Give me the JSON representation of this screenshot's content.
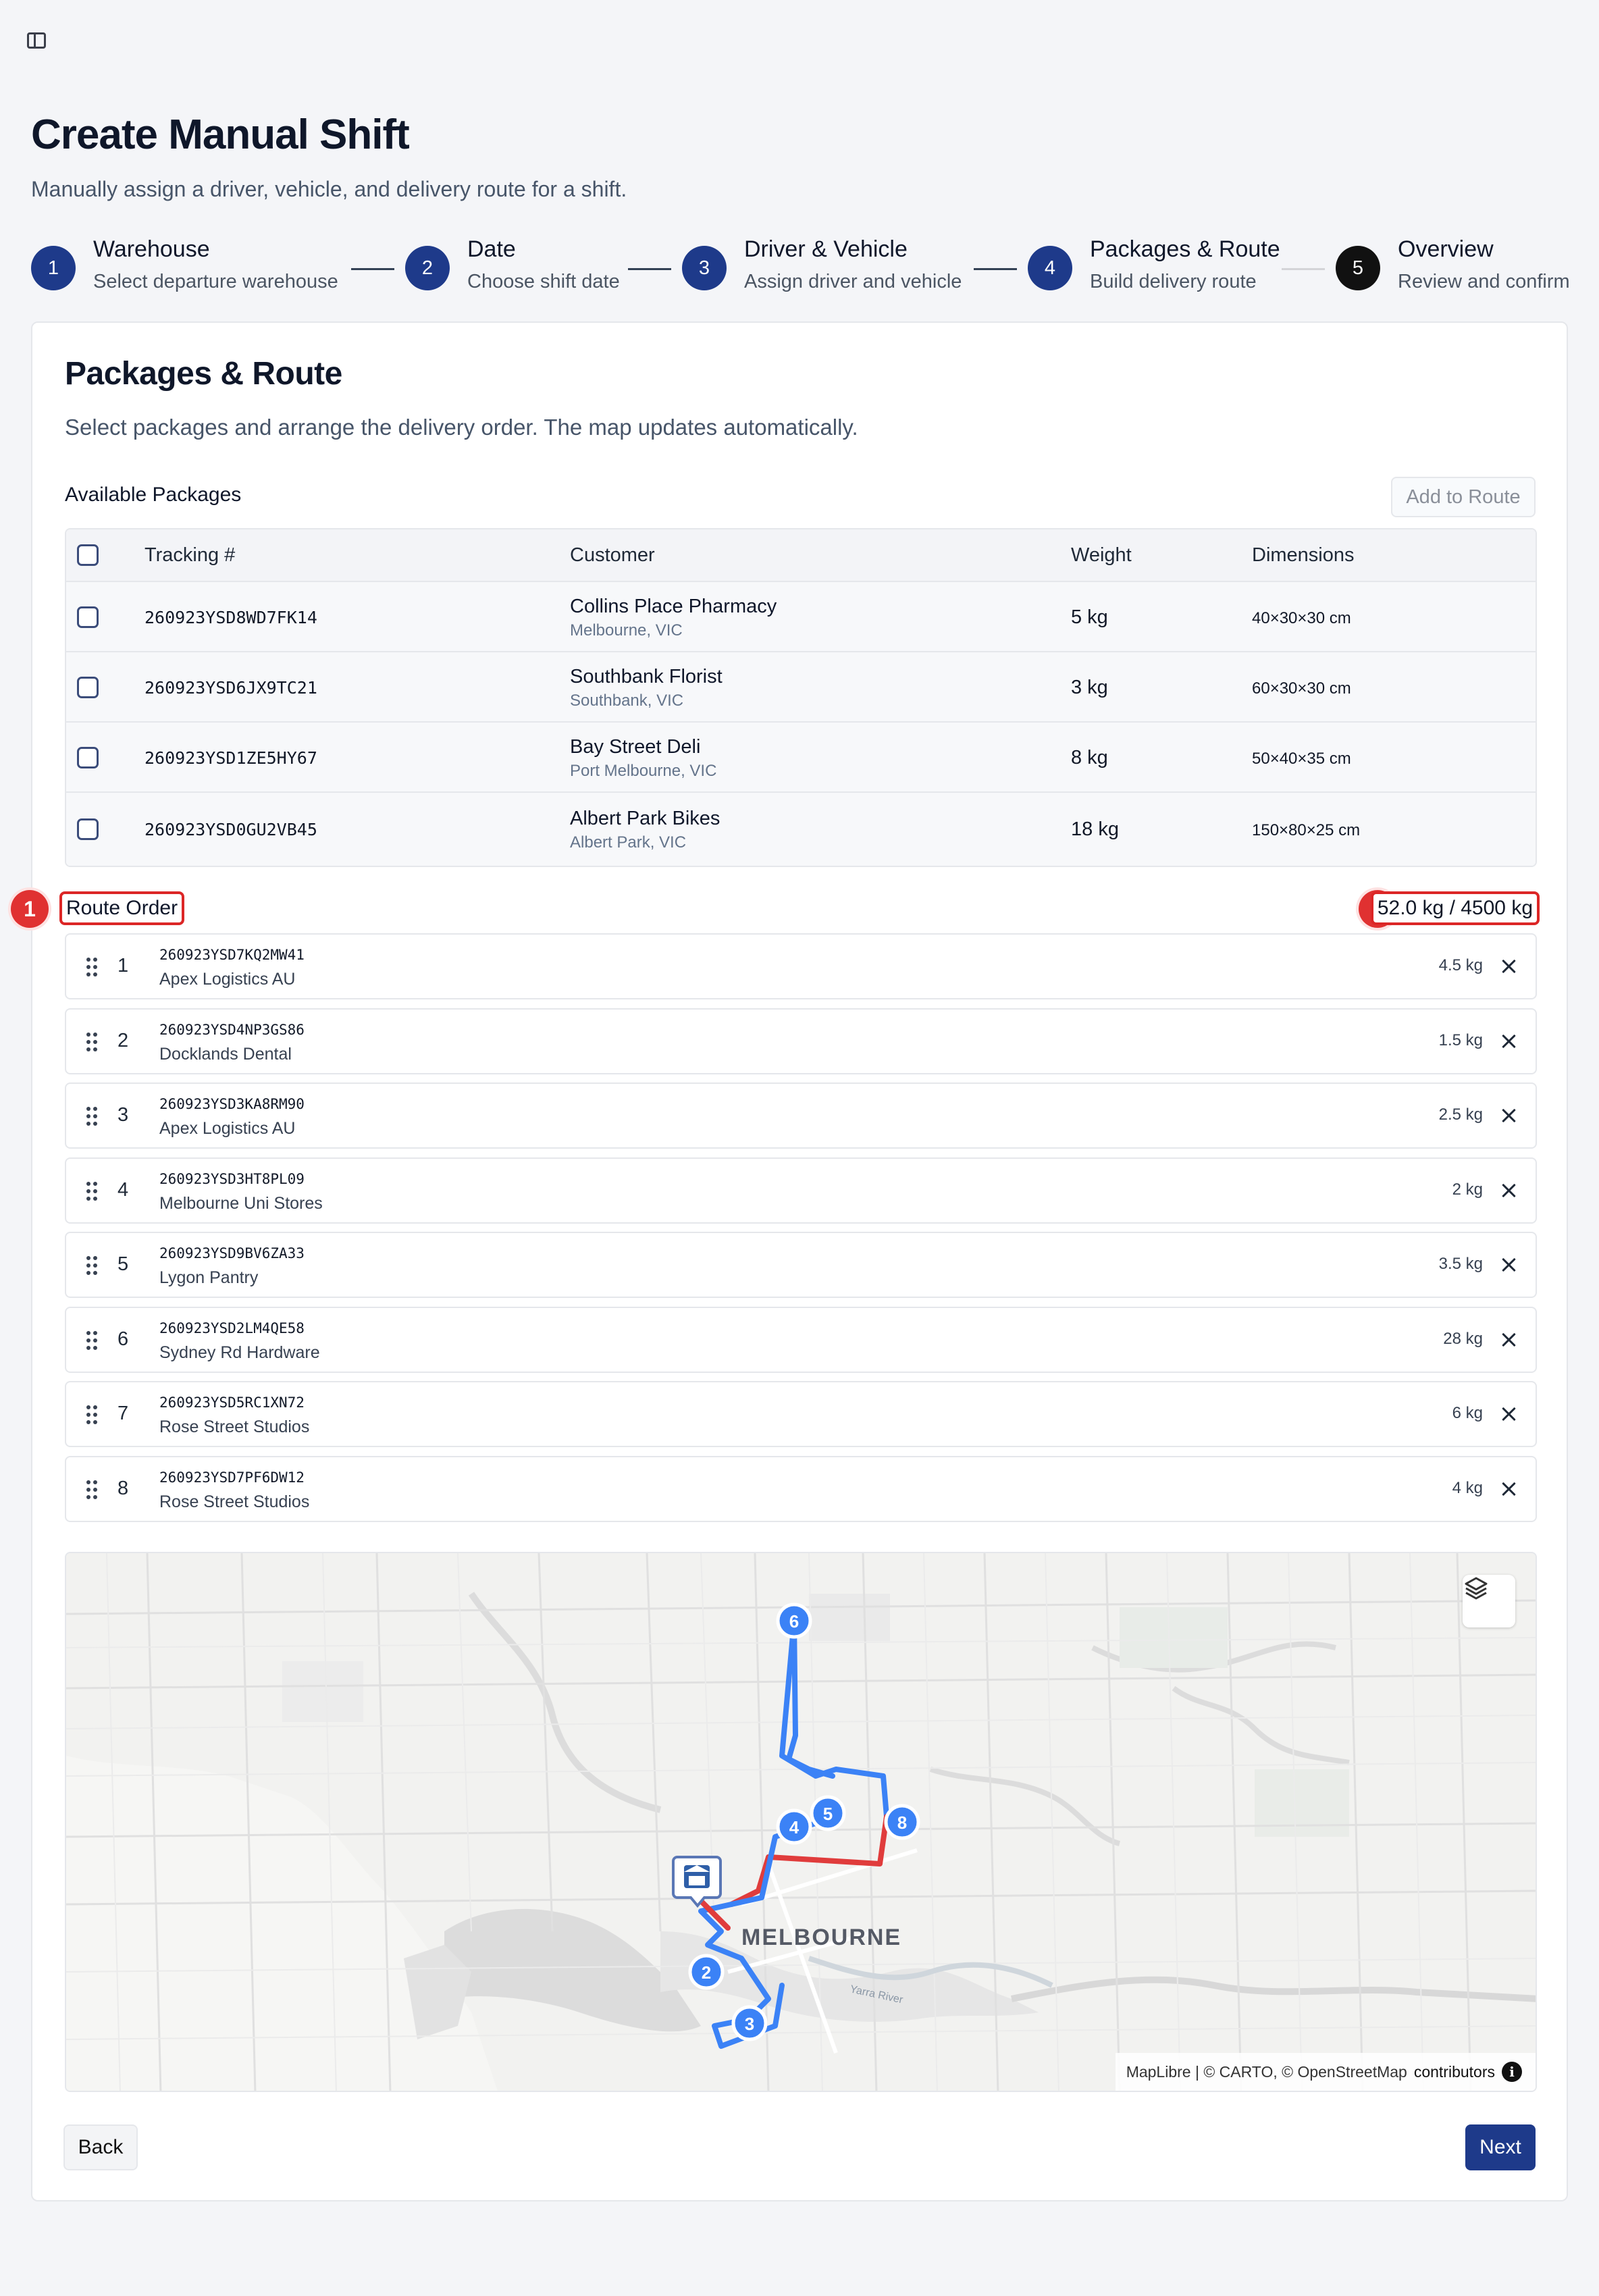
{
  "header": {
    "title": "Create Manual Shift",
    "subtitle": "Manually assign a driver, vehicle, and delivery route for a shift."
  },
  "steps": [
    {
      "number": "1",
      "title": "Warehouse",
      "description": "Select departure warehouse",
      "state": "complete"
    },
    {
      "number": "2",
      "title": "Date",
      "description": "Choose shift date",
      "state": "complete"
    },
    {
      "number": "3",
      "title": "Driver & Vehicle",
      "description": "Assign driver and vehicle",
      "state": "complete"
    },
    {
      "number": "4",
      "title": "Packages & Route",
      "description": "Build delivery route",
      "state": "current"
    },
    {
      "number": "5",
      "title": "Overview",
      "description": "Review and confirm",
      "state": "upcoming"
    }
  ],
  "card": {
    "title": "Packages & Route",
    "description": "Select packages and arrange the delivery order. The map updates automatically."
  },
  "available": {
    "label": "Available Packages",
    "add_button": "Add to Route",
    "columns": [
      "Tracking #",
      "Customer",
      "Weight",
      "Dimensions"
    ],
    "rows": [
      {
        "tracking": "260923YSD8WD7FK14",
        "customer": "Collins Place Pharmacy",
        "location": "Melbourne, VIC",
        "weight": "5 kg",
        "dimensions": "40×30×30 cm"
      },
      {
        "tracking": "260923YSD6JX9TC21",
        "customer": "Southbank Florist",
        "location": "Southbank, VIC",
        "weight": "3 kg",
        "dimensions": "60×30×30 cm"
      },
      {
        "tracking": "260923YSD1ZE5HY67",
        "customer": "Bay Street Deli",
        "location": "Port Melbourne, VIC",
        "weight": "8 kg",
        "dimensions": "50×40×35 cm"
      },
      {
        "tracking": "260923YSD0GU2VB45",
        "customer": "Albert Park Bikes",
        "location": "Albert Park, VIC",
        "weight": "18 kg",
        "dimensions": "150×80×25 cm"
      }
    ]
  },
  "route": {
    "label": "Route Order",
    "weight_summary": "52.0 kg / 4500 kg",
    "annotations": [
      "1",
      "2"
    ],
    "items": [
      {
        "order": "1",
        "tracking": "260923YSD7KQ2MW41",
        "customer": "Apex Logistics AU",
        "weight": "4.5 kg"
      },
      {
        "order": "2",
        "tracking": "260923YSD4NP3GS86",
        "customer": "Docklands Dental",
        "weight": "1.5 kg"
      },
      {
        "order": "3",
        "tracking": "260923YSD3KA8RM90",
        "customer": "Apex Logistics AU",
        "weight": "2.5 kg"
      },
      {
        "order": "4",
        "tracking": "260923YSD3HT8PL09",
        "customer": "Melbourne Uni Stores",
        "weight": "2 kg"
      },
      {
        "order": "5",
        "tracking": "260923YSD9BV6ZA33",
        "customer": "Lygon Pantry",
        "weight": "3.5 kg"
      },
      {
        "order": "6",
        "tracking": "260923YSD2LM4QE58",
        "customer": "Sydney Rd Hardware",
        "weight": "28 kg"
      },
      {
        "order": "7",
        "tracking": "260923YSD5RC1XN72",
        "customer": "Rose Street Studios",
        "weight": "6 kg"
      },
      {
        "order": "8",
        "tracking": "260923YSD7PF6DW12",
        "customer": "Rose Street Studios",
        "weight": "4 kg"
      }
    ]
  },
  "map": {
    "city_label": "MELBOURNE",
    "river_label": "Yarra River",
    "markers": [
      "2",
      "3",
      "4",
      "5",
      "6",
      "8"
    ],
    "route_color": "#3b82f6",
    "return_color": "#e03c3c",
    "attribution_prefix": "MapLibre | © CARTO, © OpenStreetMap",
    "attribution_suffix": "contributors",
    "info_glyph": "i",
    "icons": {
      "layers": "layers-icon",
      "warehouse": "warehouse-marker-icon",
      "info": "info-icon"
    }
  },
  "footer": {
    "back": "Back",
    "next": "Next"
  }
}
